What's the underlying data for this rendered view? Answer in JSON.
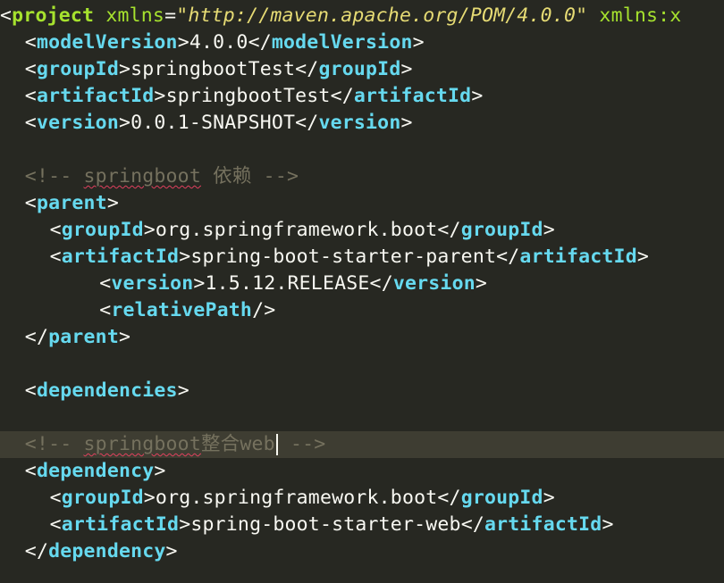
{
  "theme": {
    "background": "#272822",
    "current_line": "#3e3d32",
    "tag": "#66d9ef",
    "root_tag": "#a6e22e",
    "text": "#f8f8f2",
    "string": "#e6db74",
    "comment": "#75715e"
  },
  "editor": {
    "lines": [
      {
        "indent": 0,
        "tokens": [
          {
            "t": "bracket",
            "v": "<"
          },
          {
            "t": "tag-root",
            "v": "project"
          },
          {
            "t": "text",
            "v": " "
          },
          {
            "t": "attr",
            "v": "xmlns"
          },
          {
            "t": "text",
            "v": "="
          },
          {
            "t": "string",
            "v": "\"http://maven.apache.org/POM/4.0.0\""
          },
          {
            "t": "text",
            "v": " "
          },
          {
            "t": "attr",
            "v": "xmlns:x"
          }
        ]
      },
      {
        "indent": 2,
        "tokens": [
          {
            "t": "bracket",
            "v": "<"
          },
          {
            "t": "tag",
            "v": "modelVersion"
          },
          {
            "t": "bracket",
            "v": ">"
          },
          {
            "t": "text",
            "v": "4.0.0"
          },
          {
            "t": "bracket",
            "v": "</"
          },
          {
            "t": "tag",
            "v": "modelVersion"
          },
          {
            "t": "bracket",
            "v": ">"
          }
        ]
      },
      {
        "indent": 2,
        "tokens": [
          {
            "t": "bracket",
            "v": "<"
          },
          {
            "t": "tag",
            "v": "groupId"
          },
          {
            "t": "bracket",
            "v": ">"
          },
          {
            "t": "text",
            "v": "springbootTest"
          },
          {
            "t": "bracket",
            "v": "</"
          },
          {
            "t": "tag",
            "v": "groupId"
          },
          {
            "t": "bracket",
            "v": ">"
          }
        ]
      },
      {
        "indent": 2,
        "tokens": [
          {
            "t": "bracket",
            "v": "<"
          },
          {
            "t": "tag",
            "v": "artifactId"
          },
          {
            "t": "bracket",
            "v": ">"
          },
          {
            "t": "text",
            "v": "springbootTest"
          },
          {
            "t": "bracket",
            "v": "</"
          },
          {
            "t": "tag",
            "v": "artifactId"
          },
          {
            "t": "bracket",
            "v": ">"
          }
        ]
      },
      {
        "indent": 2,
        "tokens": [
          {
            "t": "bracket",
            "v": "<"
          },
          {
            "t": "tag",
            "v": "version"
          },
          {
            "t": "bracket",
            "v": ">"
          },
          {
            "t": "text",
            "v": "0.0.1-SNAPSHOT"
          },
          {
            "t": "bracket",
            "v": "</"
          },
          {
            "t": "tag",
            "v": "version"
          },
          {
            "t": "bracket",
            "v": ">"
          }
        ]
      },
      {
        "indent": 0,
        "tokens": []
      },
      {
        "indent": 2,
        "tokens": [
          {
            "t": "comment",
            "v": "<!-- "
          },
          {
            "t": "comment-spell",
            "v": "springboot"
          },
          {
            "t": "comment",
            "v": " 依赖 -->"
          }
        ]
      },
      {
        "indent": 2,
        "tokens": [
          {
            "t": "bracket",
            "v": "<"
          },
          {
            "t": "tag",
            "v": "parent"
          },
          {
            "t": "bracket",
            "v": ">"
          }
        ]
      },
      {
        "indent": 4,
        "tokens": [
          {
            "t": "bracket",
            "v": "<"
          },
          {
            "t": "tag",
            "v": "groupId"
          },
          {
            "t": "bracket",
            "v": ">"
          },
          {
            "t": "text",
            "v": "org.springframework.boot"
          },
          {
            "t": "bracket",
            "v": "</"
          },
          {
            "t": "tag",
            "v": "groupId"
          },
          {
            "t": "bracket",
            "v": ">"
          }
        ]
      },
      {
        "indent": 4,
        "tokens": [
          {
            "t": "bracket",
            "v": "<"
          },
          {
            "t": "tag",
            "v": "artifactId"
          },
          {
            "t": "bracket",
            "v": ">"
          },
          {
            "t": "text",
            "v": "spring-boot-starter-parent"
          },
          {
            "t": "bracket",
            "v": "</"
          },
          {
            "t": "tag",
            "v": "artifactId"
          },
          {
            "t": "bracket",
            "v": ">"
          }
        ]
      },
      {
        "indent": 8,
        "tokens": [
          {
            "t": "bracket",
            "v": "<"
          },
          {
            "t": "tag",
            "v": "version"
          },
          {
            "t": "bracket",
            "v": ">"
          },
          {
            "t": "text",
            "v": "1.5.12.RELEASE"
          },
          {
            "t": "bracket",
            "v": "</"
          },
          {
            "t": "tag",
            "v": "version"
          },
          {
            "t": "bracket",
            "v": ">"
          }
        ]
      },
      {
        "indent": 8,
        "tokens": [
          {
            "t": "bracket",
            "v": "<"
          },
          {
            "t": "tag",
            "v": "relativePath"
          },
          {
            "t": "bracket",
            "v": "/>"
          }
        ]
      },
      {
        "indent": 2,
        "tokens": [
          {
            "t": "bracket",
            "v": "</"
          },
          {
            "t": "tag",
            "v": "parent"
          },
          {
            "t": "bracket",
            "v": ">"
          }
        ]
      },
      {
        "indent": 0,
        "tokens": []
      },
      {
        "indent": 2,
        "tokens": [
          {
            "t": "bracket",
            "v": "<"
          },
          {
            "t": "tag",
            "v": "dependencies"
          },
          {
            "t": "bracket",
            "v": ">"
          }
        ]
      },
      {
        "indent": 0,
        "tokens": []
      },
      {
        "indent": 2,
        "current": true,
        "tokens": [
          {
            "t": "comment",
            "v": "<!-- "
          },
          {
            "t": "comment-spell",
            "v": "springboot"
          },
          {
            "t": "comment",
            "v": "整合web"
          },
          {
            "t": "caret",
            "v": ""
          },
          {
            "t": "comment",
            "v": " -->"
          }
        ]
      },
      {
        "indent": 2,
        "tokens": [
          {
            "t": "bracket",
            "v": "<"
          },
          {
            "t": "tag",
            "v": "dependency"
          },
          {
            "t": "bracket",
            "v": ">"
          }
        ]
      },
      {
        "indent": 4,
        "tokens": [
          {
            "t": "bracket",
            "v": "<"
          },
          {
            "t": "tag",
            "v": "groupId"
          },
          {
            "t": "bracket",
            "v": ">"
          },
          {
            "t": "text",
            "v": "org.springframework.boot"
          },
          {
            "t": "bracket",
            "v": "</"
          },
          {
            "t": "tag",
            "v": "groupId"
          },
          {
            "t": "bracket",
            "v": ">"
          }
        ]
      },
      {
        "indent": 4,
        "tokens": [
          {
            "t": "bracket",
            "v": "<"
          },
          {
            "t": "tag",
            "v": "artifactId"
          },
          {
            "t": "bracket",
            "v": ">"
          },
          {
            "t": "text",
            "v": "spring-boot-starter-web"
          },
          {
            "t": "bracket",
            "v": "</"
          },
          {
            "t": "tag",
            "v": "artifactId"
          },
          {
            "t": "bracket",
            "v": ">"
          }
        ]
      },
      {
        "indent": 2,
        "tokens": [
          {
            "t": "bracket",
            "v": "</"
          },
          {
            "t": "tag",
            "v": "dependency"
          },
          {
            "t": "bracket",
            "v": ">"
          }
        ]
      }
    ]
  }
}
